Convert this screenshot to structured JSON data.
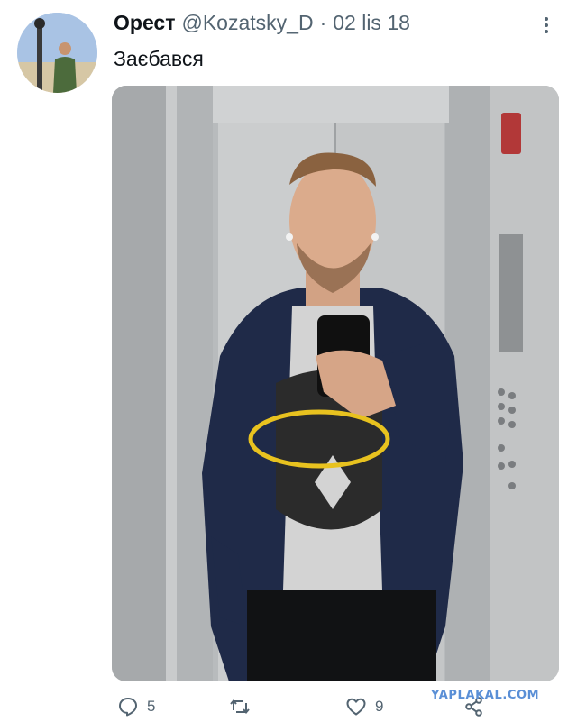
{
  "tweet": {
    "author_name": "Орест",
    "handle": "@Kozatsky_D",
    "separator": "·",
    "date": "02 lis 18",
    "text": "Заєбався"
  },
  "icons": {
    "avatar": "profile-photo",
    "more": "more-vertical-icon",
    "reply": "reply-icon",
    "retweet": "retweet-icon",
    "like": "heart-icon",
    "share": "share-icon"
  },
  "actions": {
    "reply_count": "5",
    "like_count": "9"
  },
  "watermark": "YAPLAKAL.COM",
  "colors": {
    "text": "#0f1419",
    "secondary": "#536471",
    "highlight_circle": "#e8c21f",
    "watermark": "#5a8fd6"
  }
}
